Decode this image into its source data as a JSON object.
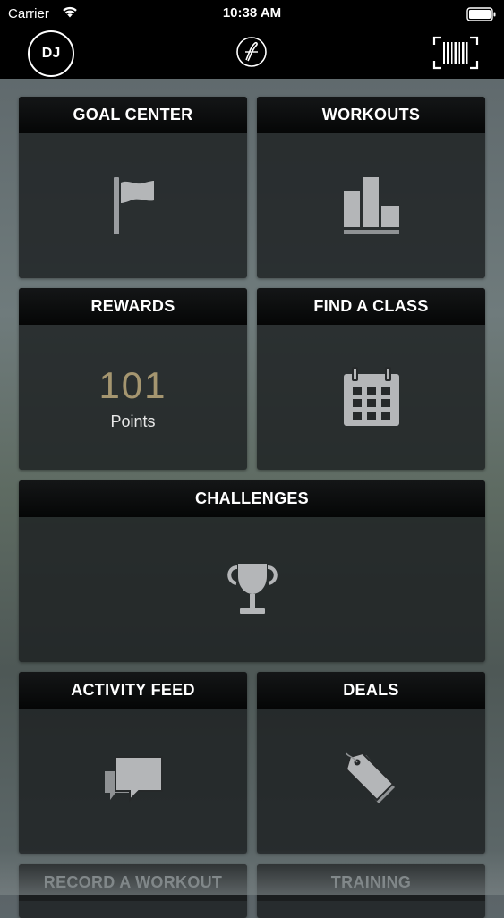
{
  "status": {
    "carrier": "Carrier",
    "time": "10:38 AM"
  },
  "nav": {
    "avatar_initials": "DJ",
    "logo_icon": "logo-icon",
    "barcode_icon": "barcode-icon"
  },
  "tiles": {
    "goal_center": {
      "title": "GOAL CENTER",
      "icon": "flag-icon"
    },
    "workouts": {
      "title": "WORKOUTS",
      "icon": "bar-chart-icon"
    },
    "rewards": {
      "title": "REWARDS",
      "points": "101",
      "points_label": "Points"
    },
    "find_a_class": {
      "title": "FIND A CLASS",
      "icon": "calendar-icon"
    },
    "challenges": {
      "title": "CHALLENGES",
      "icon": "trophy-icon"
    },
    "activity_feed": {
      "title": "ACTIVITY FEED",
      "icon": "chat-bubbles-icon"
    },
    "deals": {
      "title": "DEALS",
      "icon": "tag-icon"
    },
    "record_a_workout": {
      "title": "RECORD A WORKOUT"
    },
    "training": {
      "title": "TRAINING"
    }
  },
  "colors": {
    "accent_points": "#a59670",
    "tile_bg": "#1c2021",
    "header_bg": "#050606"
  }
}
